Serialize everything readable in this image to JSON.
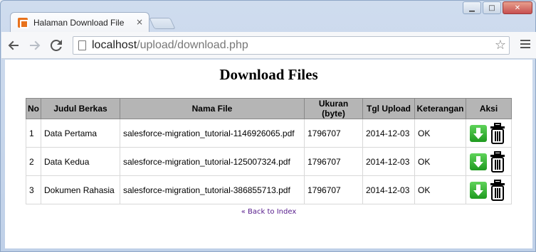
{
  "browser": {
    "tab_title": "Halaman Download File",
    "tab_close": "×",
    "url_host": "localhost",
    "url_path": "/upload/download.php",
    "window_buttons": [
      "▁",
      "□",
      "✕"
    ]
  },
  "page": {
    "heading": "Download Files",
    "table": {
      "headers": [
        "No",
        "Judul Berkas",
        "Nama File",
        "Ukuran (byte)",
        "Tgl Upload",
        "Keterangan",
        "Aksi"
      ],
      "rows": [
        {
          "no": "1",
          "judul": "Data Pertama",
          "nama": "salesforce-migration_tutorial-1146926065.pdf",
          "ukuran": "1796707",
          "tgl": "2014-12-03",
          "ket": "OK"
        },
        {
          "no": "2",
          "judul": "Data Kedua",
          "nama": "salesforce-migration_tutorial-125007324.pdf",
          "ukuran": "1796707",
          "tgl": "2014-12-03",
          "ket": "OK"
        },
        {
          "no": "3",
          "judul": "Dokumen Rahasia",
          "nama": "salesforce-migration_tutorial-386855713.pdf",
          "ukuran": "1796707",
          "tgl": "2014-12-03",
          "ket": "OK"
        }
      ]
    },
    "back_link": "« Back to Index"
  },
  "icons": {
    "download": "download-icon",
    "delete": "trash-icon"
  },
  "colors": {
    "table_header_bg": "#b5b5b5",
    "download_green": "#2aa82a",
    "link_visited": "#551a8b"
  }
}
